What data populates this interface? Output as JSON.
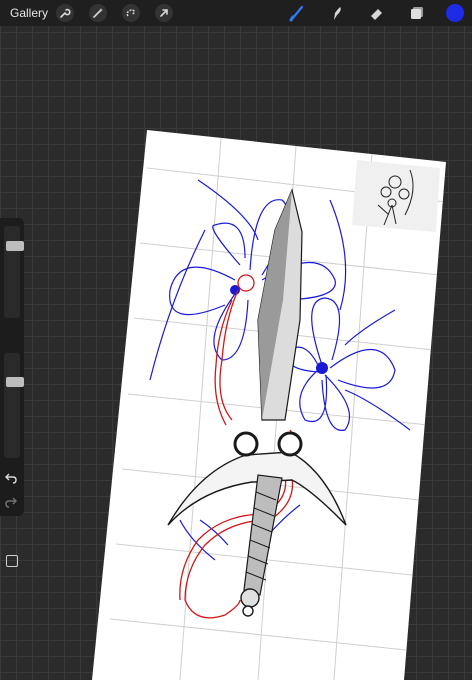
{
  "topbar": {
    "gallery_label": "Gallery",
    "left_tools": [
      "wrench-icon",
      "magic-wand-icon",
      "selection-icon",
      "transform-icon"
    ],
    "right_tools": [
      "brush-icon",
      "smudge-icon",
      "eraser-icon",
      "layers-icon"
    ],
    "active_tool": "brush-icon",
    "accent_color": "#2f7cf6",
    "current_color": "#1d2be6"
  },
  "sidebar": {
    "size_slider": 0.82,
    "opacity_slider": 0.75,
    "icons": [
      "modify-button-icon",
      "undo-icon",
      "redo-icon"
    ]
  },
  "canvas": {
    "background": "#ffffff",
    "grid_color": "#c9c9c9",
    "ink_colors": {
      "blue": "#1a1ad6",
      "red": "#d01818",
      "black": "#1a1a1a"
    }
  }
}
